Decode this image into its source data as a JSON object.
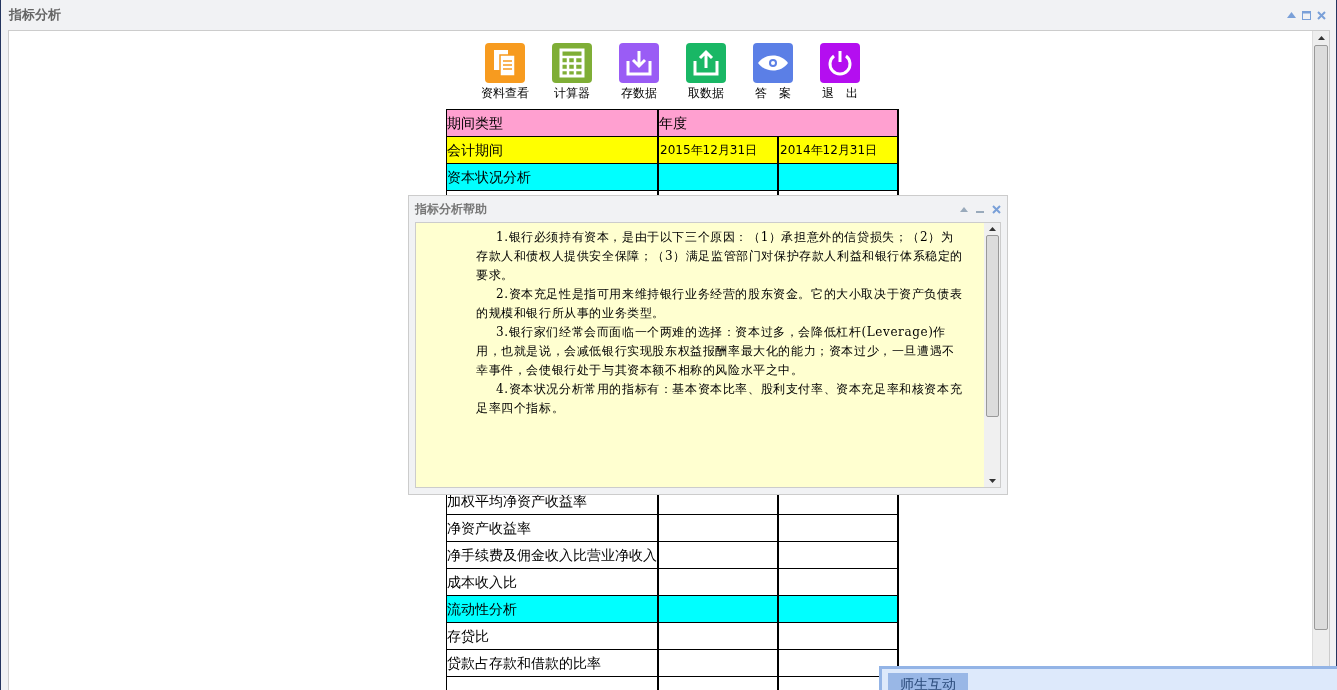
{
  "window": {
    "title": "指标分析"
  },
  "toolbar": [
    {
      "label": "资料查看",
      "kind": "docs",
      "color": "#f79b1f"
    },
    {
      "label": "计算器",
      "kind": "calculator",
      "color": "#7fae36"
    },
    {
      "label": "存数据",
      "kind": "save",
      "color": "#9a5cf5"
    },
    {
      "label": "取数据",
      "kind": "load",
      "color": "#19b765"
    },
    {
      "label": "答　案",
      "kind": "answer",
      "color": "#5b7fe6"
    },
    {
      "label": "退　出",
      "kind": "exit",
      "color": "#b40ef0"
    }
  ],
  "table": {
    "header": {
      "label": "期间类型",
      "value": "年度"
    },
    "period": {
      "label": "会计期间",
      "columns": [
        "2015年12月31日",
        "2014年12月31日"
      ]
    },
    "rows_top": [
      {
        "label": "资本状况分析",
        "kind": "section"
      }
    ],
    "rows_bottom": [
      {
        "label": "加权平均净资产收益率",
        "kind": "item"
      },
      {
        "label": "净资产收益率",
        "kind": "item"
      },
      {
        "label": "净手续费及佣金收入比营业净收入",
        "kind": "item"
      },
      {
        "label": "成本收入比",
        "kind": "item"
      },
      {
        "label": "流动性分析",
        "kind": "section"
      },
      {
        "label": "存贷比",
        "kind": "item"
      },
      {
        "label": "贷款占存款和借款的比率",
        "kind": "item"
      }
    ]
  },
  "dialog": {
    "title": "指标分析帮助",
    "paragraphs": [
      "1.银行必须持有资本，是由于以下三个原因：（1）承担意外的信贷损失；（2）为存款人和债权人提供安全保障；（3）满足监管部门对保护存款人利益和银行体系稳定的要求。",
      "2.资本充足性是指可用来维持银行业务经营的股东资金。它的大小取决于资产负债表的规模和银行所从事的业务类型。",
      "3.银行家们经常会而面临一个两难的选择：资本过多，会降低杠杆(Leverage)作用，也就是说，会减低银行实现股东权益报酬率最大化的能力；资本过少，一旦遭遇不幸事件，会使银行处于与其资本额不相称的风险水平之中。",
      "4.资本状况分析常用的指标有：基本资本比率、股利支付率、资本充足率和核资本充足率四个指标。"
    ]
  },
  "interaction_panel": {
    "tab": "师生互动"
  }
}
